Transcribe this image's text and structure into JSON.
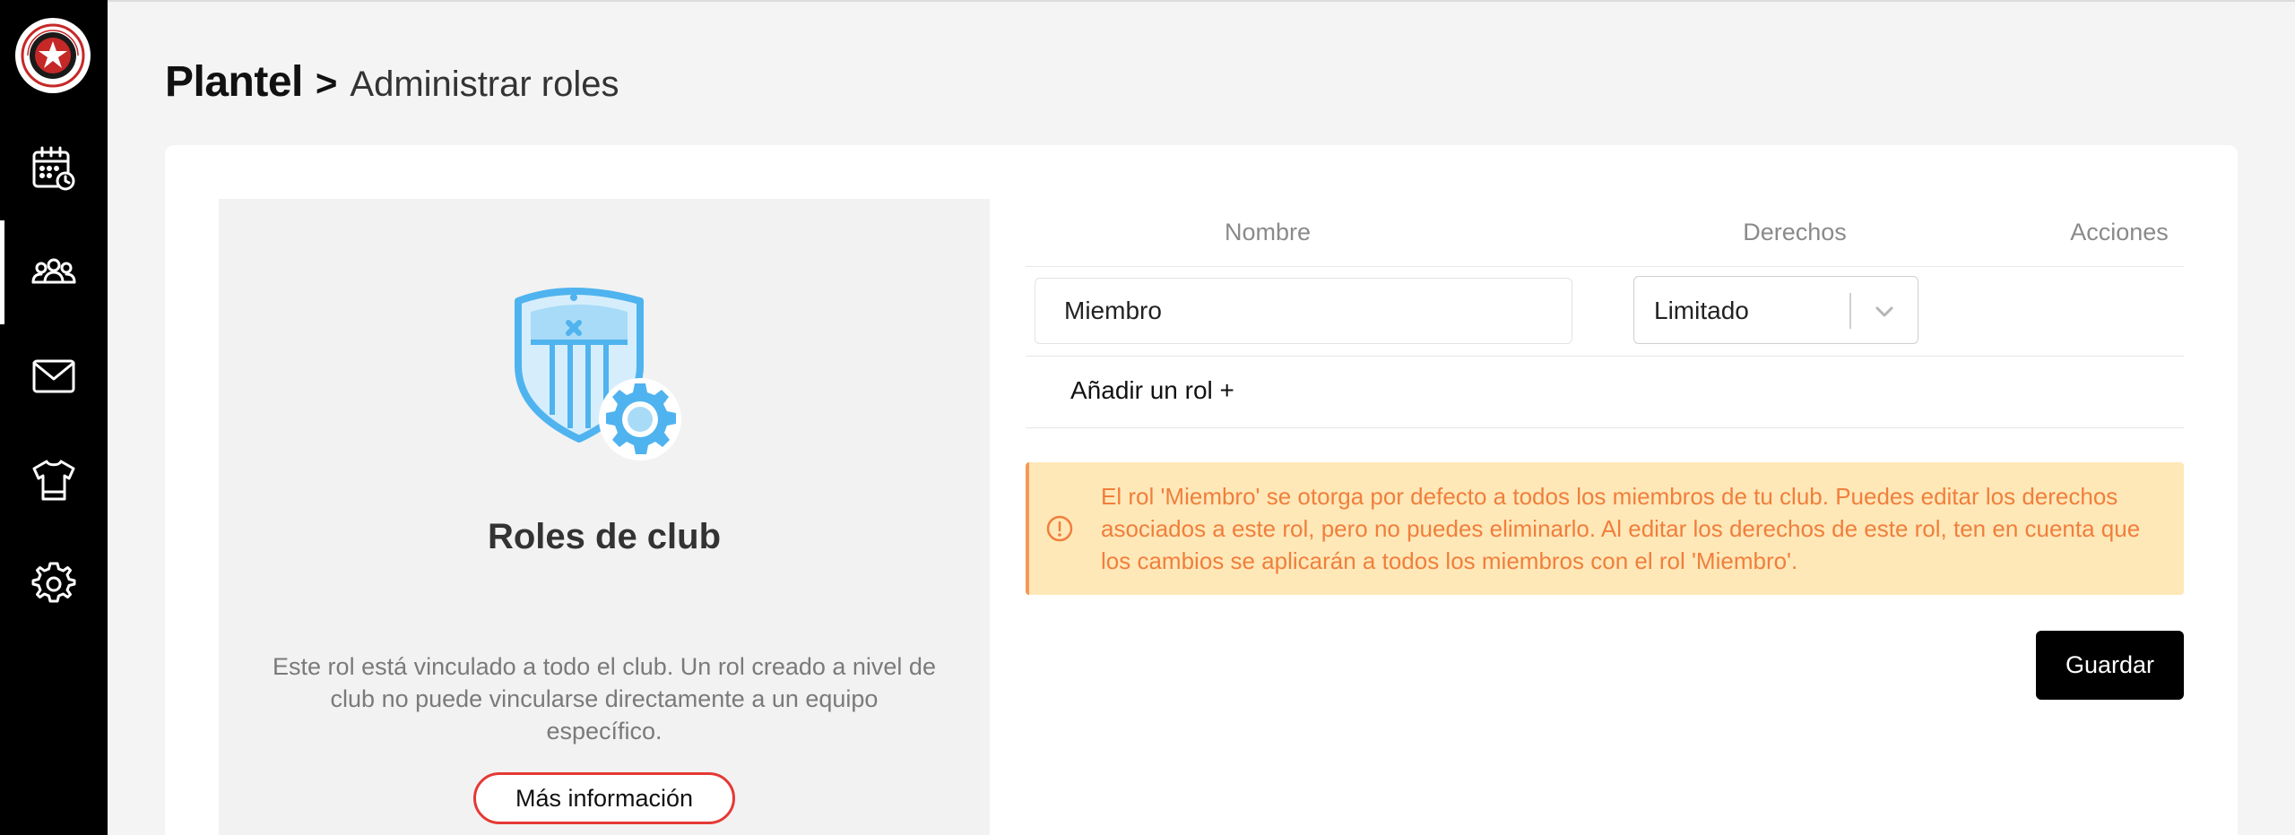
{
  "sidebar": {
    "logo_alt": "Galacticos FC",
    "items": [
      {
        "icon": "calendar-icon",
        "active": false
      },
      {
        "icon": "team-icon",
        "active": true
      },
      {
        "icon": "mail-icon",
        "active": false
      },
      {
        "icon": "jersey-icon",
        "active": false
      },
      {
        "icon": "gear-icon",
        "active": false
      }
    ]
  },
  "header": {
    "root": "Plantel",
    "separator": ">",
    "current": "Administrar roles"
  },
  "left_panel": {
    "title": "Roles de club",
    "description": "Este rol está vinculado a todo el club. Un rol creado a nivel de club no puede vincularse directamente a un equipo específico.",
    "more_info_label": "Más información"
  },
  "table": {
    "columns": {
      "name": "Nombre",
      "rights": "Derechos",
      "actions": "Acciones"
    },
    "rows": [
      {
        "name": "Miembro",
        "rights": "Limitado"
      }
    ],
    "add_role_label": "Añadir un rol +"
  },
  "alert": {
    "text": "El rol 'Miembro' se otorga por defecto a todos los miembros de tu club. Puedes editar los derechos asociados a este rol, pero no puedes eliminarlo. Al editar los derechos de este rol, ten en cuenta que los cambios se aplicarán a todos los miembros con el rol 'Miembro'."
  },
  "actions": {
    "save_label": "Guardar"
  },
  "colors": {
    "sidebar_bg": "#000000",
    "alert_bg": "#ffe8b8",
    "alert_text": "#f07f3c",
    "highlight_border": "#e53935",
    "illustration_blue": "#4fb3ef"
  }
}
